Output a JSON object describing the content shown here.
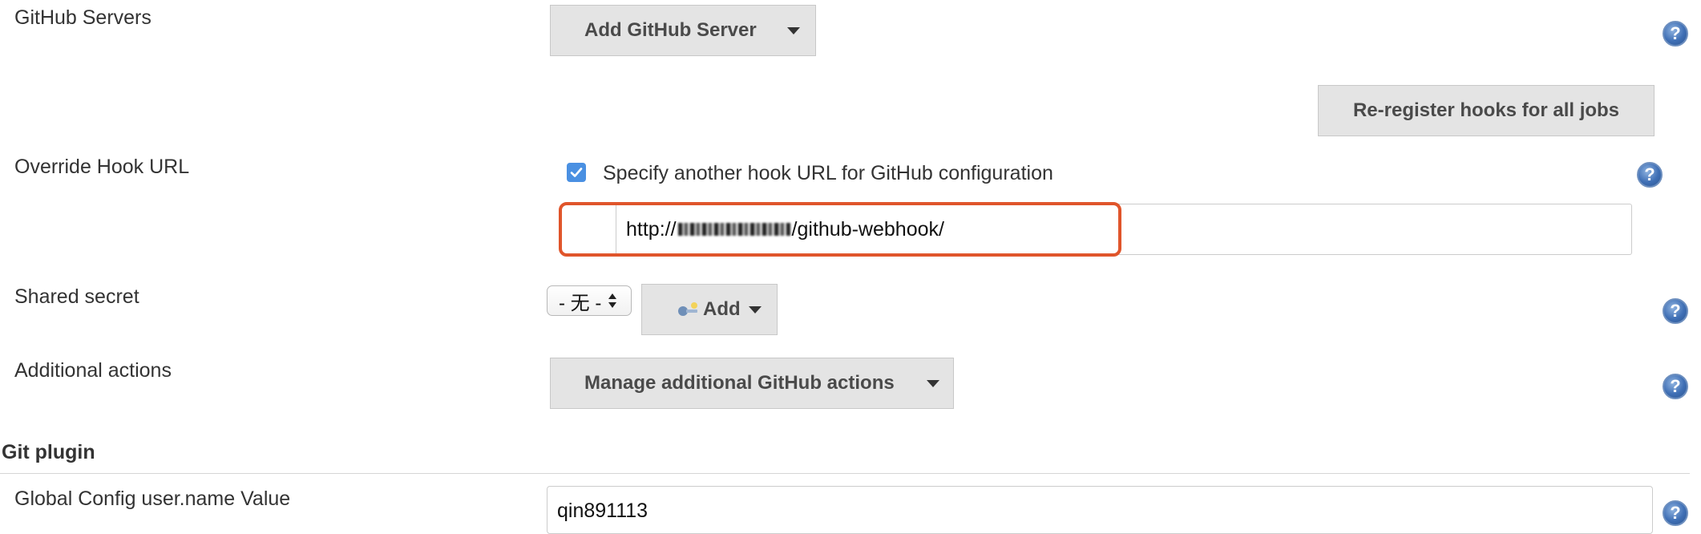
{
  "github_servers": {
    "label": "GitHub Servers",
    "add_button_label": "Add GitHub Server",
    "reregister_button_label": "Re-register hooks for all jobs"
  },
  "override_hook_url": {
    "label": "Override Hook URL",
    "checkbox_label": "Specify another hook URL for GitHub configuration",
    "checked": true,
    "url_prefix": "http://",
    "url_suffix": "/github-webhook/"
  },
  "shared_secret": {
    "label": "Shared secret",
    "select_value": "- 无 -",
    "add_button_label": "Add"
  },
  "additional_actions": {
    "label": "Additional actions",
    "manage_button_label": "Manage additional GitHub actions"
  },
  "git_plugin": {
    "section_title": "Git plugin",
    "user_name_label": "Global Config user.name Value",
    "user_name_value": "qin891113"
  },
  "colors": {
    "highlight_border": "#e0552b",
    "checkbox_blue": "#4a90e2",
    "button_bg": "#e4e4e4",
    "help_icon": "#3f6fb5"
  },
  "icons": {
    "help": "help-icon",
    "dropdown": "caret-down-icon",
    "key": "key-icon",
    "checkbox": "checkbox-checked-icon"
  }
}
